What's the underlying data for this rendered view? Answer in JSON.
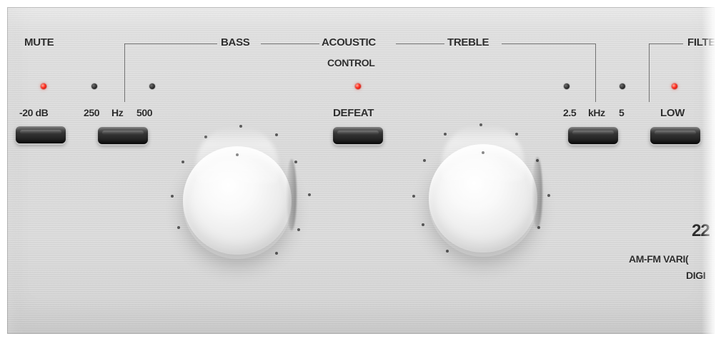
{
  "labels": {
    "mute": "MUTE",
    "minus20db": "-20 dB",
    "bass": "BASS",
    "acoustic": "ACOUSTIC",
    "control": "CONTROL",
    "treble": "TREBLE",
    "filter": "FILTE",
    "bass_250": "250",
    "bass_hz": "Hz",
    "bass_500": "500",
    "defeat": "DEFEAT",
    "treble_25": "2.5",
    "treble_khz": "kHz",
    "treble_5": "5",
    "low": "LOW",
    "model_fragment": "22",
    "description_fragment_1": "AM-FM VARI(",
    "description_fragment_2": "DIGI"
  },
  "colors": {
    "panel": "#d9d9d9",
    "text": "#2e2e2e",
    "led_on": "#ff2d1f",
    "led_off": "#2b2b2b",
    "switch": "#2a2a2a",
    "knob": "#f7f7f7"
  },
  "indicators": {
    "mute": "on",
    "bass_250": "off",
    "bass_500": "off",
    "defeat": "on",
    "treble_25": "off",
    "treble_5": "off",
    "low_filter": "on"
  }
}
